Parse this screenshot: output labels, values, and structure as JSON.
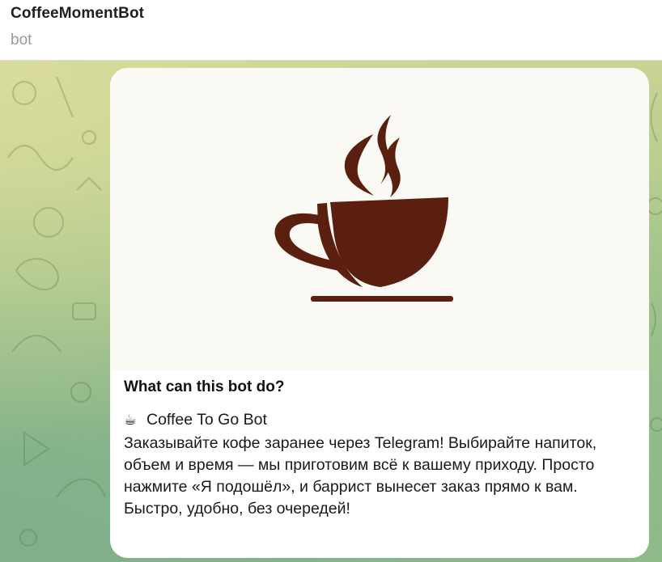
{
  "header": {
    "title": "CoffeeMomentBot",
    "status": "bot"
  },
  "bot_info": {
    "image_icon": "coffee-cup-icon",
    "heading": "What can this bot do?",
    "emoji": "☕",
    "name": "Coffee To Go Bot",
    "lines": [
      "Заказывайте кофе заранее через Telegram! Выбирайте напиток,",
      "объем и время — мы приготовим всё к вашему приходу. Просто",
      "нажмите «Я подошёл», и баррист вынесет заказ прямо к вам.",
      "Быстро, удобно, без очередей!"
    ]
  },
  "colors": {
    "coffee_brown": "#5a1f0e",
    "image_background": "#fbf9f4"
  }
}
